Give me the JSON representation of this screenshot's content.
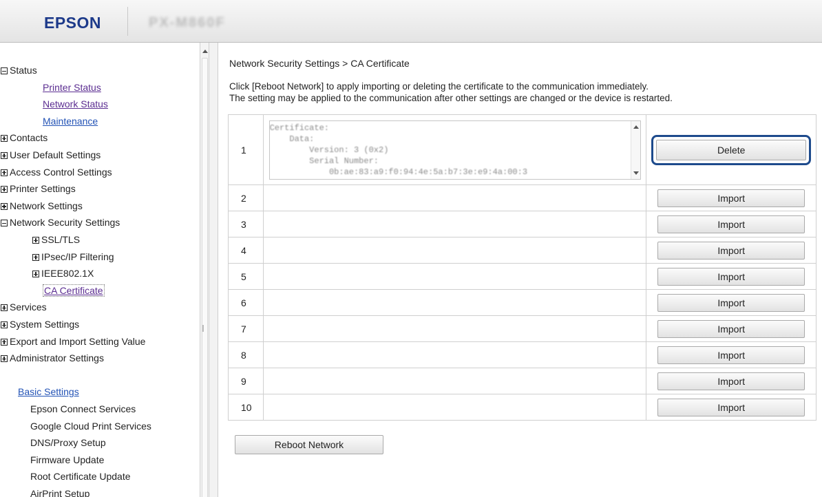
{
  "header": {
    "logo": "EPSON",
    "model": "PX-M860F"
  },
  "sidebar": {
    "items": [
      {
        "label": "Status",
        "toggle": "minus",
        "indent": 0,
        "style": "plain"
      },
      {
        "label": "Printer Status",
        "indent": 2,
        "style": "link"
      },
      {
        "label": "Network Status",
        "indent": 2,
        "style": "link"
      },
      {
        "label": "Maintenance",
        "indent": 2,
        "style": "link-blue"
      },
      {
        "label": "Contacts",
        "toggle": "plus",
        "indent": 0,
        "style": "plain"
      },
      {
        "label": "User Default Settings",
        "toggle": "plus",
        "indent": 0,
        "style": "plain"
      },
      {
        "label": "Access Control Settings",
        "toggle": "plus",
        "indent": 0,
        "style": "plain"
      },
      {
        "label": "Printer Settings",
        "toggle": "plus",
        "indent": 0,
        "style": "plain"
      },
      {
        "label": "Network Settings",
        "toggle": "plus",
        "indent": 0,
        "style": "plain"
      },
      {
        "label": "Network Security Settings",
        "toggle": "minus",
        "indent": 0,
        "style": "plain"
      },
      {
        "label": "SSL/TLS",
        "toggle": "plus",
        "indent": 1,
        "style": "plain"
      },
      {
        "label": "IPsec/IP Filtering",
        "toggle": "plus",
        "indent": 1,
        "style": "plain"
      },
      {
        "label": "IEEE802.1X",
        "toggle": "plus",
        "indent": 1,
        "style": "plain"
      },
      {
        "label": "CA Certificate",
        "indent": 2,
        "style": "link-selected"
      },
      {
        "label": "Services",
        "toggle": "plus",
        "indent": 0,
        "style": "plain"
      },
      {
        "label": "System Settings",
        "toggle": "plus",
        "indent": 0,
        "style": "plain"
      },
      {
        "label": "Export and Import Setting Value",
        "toggle": "plus",
        "indent": 0,
        "style": "plain"
      },
      {
        "label": "Administrator Settings",
        "toggle": "plus",
        "indent": 0,
        "style": "plain"
      },
      {
        "label": "",
        "indent": 0,
        "style": "spacer"
      },
      {
        "label": "Basic Settings",
        "indent": 0,
        "style": "link-blue"
      },
      {
        "label": "Epson Connect Services",
        "indent": 1,
        "style": "plain"
      },
      {
        "label": "Google Cloud Print Services",
        "indent": 1,
        "style": "plain"
      },
      {
        "label": "DNS/Proxy Setup",
        "indent": 1,
        "style": "plain"
      },
      {
        "label": "Firmware Update",
        "indent": 1,
        "style": "plain"
      },
      {
        "label": "Root Certificate Update",
        "indent": 1,
        "style": "plain"
      },
      {
        "label": "AirPrint Setup",
        "indent": 1,
        "style": "plain"
      }
    ]
  },
  "main": {
    "breadcrumb": "Network Security Settings > CA Certificate",
    "info_line1": "Click [Reboot Network] to apply importing or deleting the certificate to the communication immediately.",
    "info_line2": "The setting may be applied to the communication after other settings are changed or the device is restarted.",
    "certificate_text": "Certificate:\n    Data:\n        Version: 3 (0x2)\n        Serial Number:\n            0b:ae:83:a9:f0:94:4e:5a:b7:3e:e9:4a:00:3",
    "rows": [
      {
        "number": "1",
        "button": "Delete"
      },
      {
        "number": "2",
        "button": "Import"
      },
      {
        "number": "3",
        "button": "Import"
      },
      {
        "number": "4",
        "button": "Import"
      },
      {
        "number": "5",
        "button": "Import"
      },
      {
        "number": "6",
        "button": "Import"
      },
      {
        "number": "7",
        "button": "Import"
      },
      {
        "number": "8",
        "button": "Import"
      },
      {
        "number": "9",
        "button": "Import"
      },
      {
        "number": "10",
        "button": "Import"
      }
    ],
    "reboot_label": "Reboot Network"
  },
  "colors": {
    "logo": "#1d3a8a",
    "link": "#5b2d91",
    "link_blue": "#2252b5",
    "highlight": "#1d4a8c"
  }
}
